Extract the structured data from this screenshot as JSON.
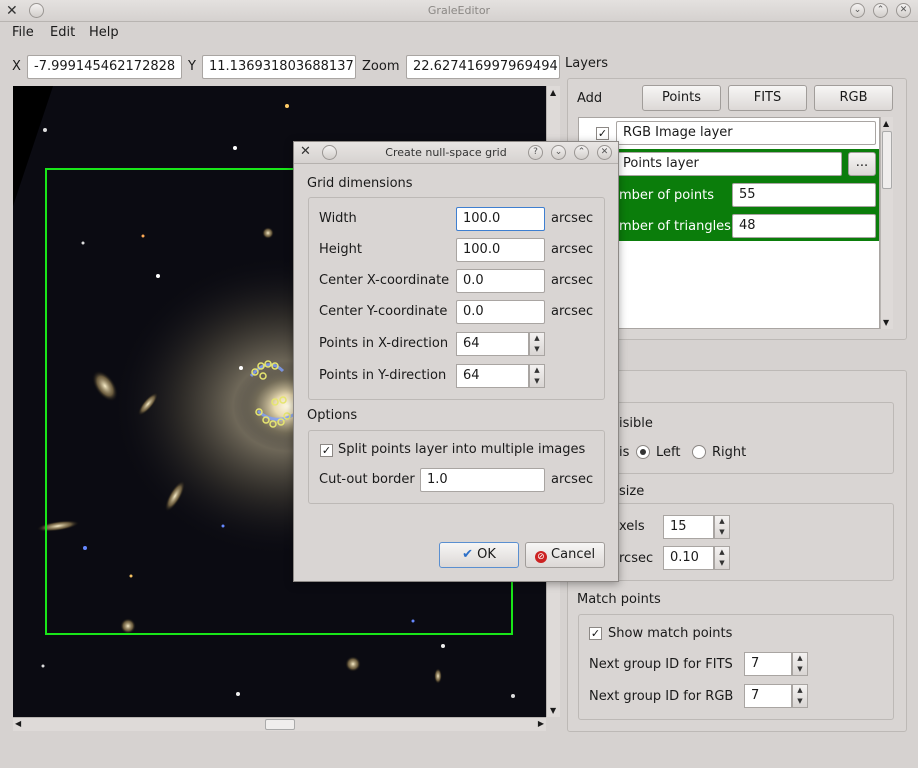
{
  "window": {
    "title": "GraleEditor"
  },
  "menu": {
    "file": "File",
    "edit": "Edit",
    "help": "Help"
  },
  "coords": {
    "x_label": "X",
    "x_value": "-7.999145462172828",
    "y_label": "Y",
    "y_value": "11.136931803688137",
    "zoom_label": "Zoom",
    "zoom_value": "22.627416997969494"
  },
  "layers": {
    "header": "Layers",
    "add_label": "Add",
    "points_button": "Points",
    "fits_button": "FITS",
    "rgb_button": "RGB",
    "rgb_layer_name": "RGB Image layer",
    "points_layer_name": "Points layer",
    "browse_button": "...",
    "num_points_label": "mber of points",
    "num_points_value": "55",
    "num_triangles_label": "mber of triangles",
    "num_triangles_value": "48"
  },
  "side": {
    "visible_label": "isible",
    "axis_label": "is",
    "left_label": "Left",
    "right_label": "Right",
    "size_label": "size",
    "pixels_label": "xels",
    "pixels_value": "15",
    "arcsec_label": "rcsec",
    "arcsec_value": "0.10",
    "match_points_title": "Match points",
    "show_match_label": "Show match points",
    "next_fits_label": "Next group ID for FITS",
    "next_fits_value": "7",
    "next_rgb_label": "Next group ID for RGB",
    "next_rgb_value": "7"
  },
  "dialog": {
    "title": "Create null-space grid",
    "grid_group": "Grid dimensions",
    "width_label": "Width",
    "width_value": "100.0",
    "height_label": "Height",
    "height_value": "100.0",
    "cx_label": "Center X-coordinate",
    "cx_value": "0.0",
    "cy_label": "Center Y-coordinate",
    "cy_value": "0.0",
    "px_label": "Points in X-direction",
    "px_value": "64",
    "py_label": "Points in Y-direction",
    "py_value": "64",
    "unit": "arcsec",
    "options_group": "Options",
    "split_label": "Split points layer into multiple images",
    "cutout_label": "Cut-out border",
    "cutout_value": "1.0",
    "ok_button": "OK",
    "cancel_button": "Cancel"
  },
  "colors": {
    "selection_green": "#0b7d0b",
    "region_box": "#19e619"
  }
}
